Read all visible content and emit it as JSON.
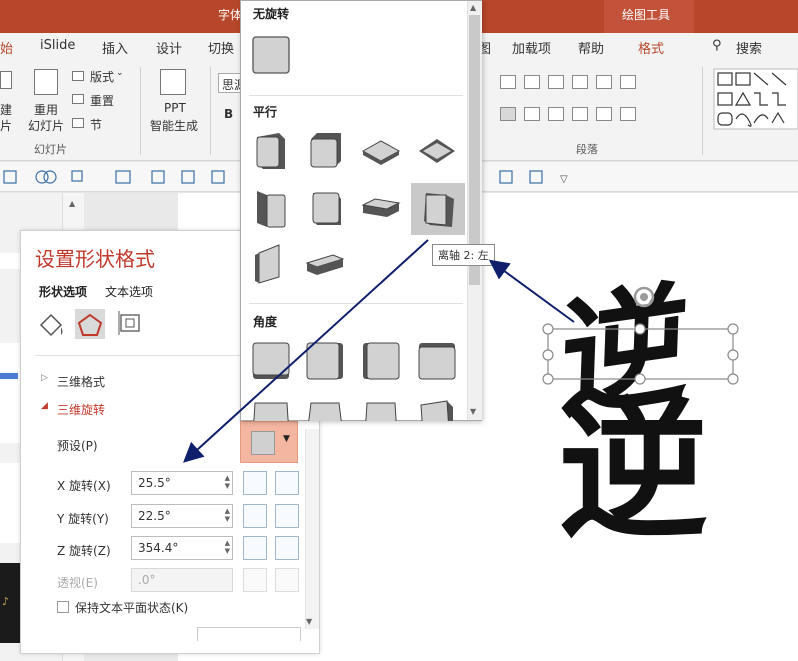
{
  "window": {
    "title": "字体",
    "context_tab": "绘图工具"
  },
  "ribbon_tabs": [
    {
      "label": "始",
      "active": true
    },
    {
      "label": "iSlide"
    },
    {
      "label": "插入"
    },
    {
      "label": "设计"
    },
    {
      "label": "切换"
    },
    {
      "label": "图"
    },
    {
      "label": "加载项"
    },
    {
      "label": "帮助"
    },
    {
      "label": "格式",
      "active": true
    },
    {
      "label": "搜索"
    }
  ],
  "ribbon": {
    "new_slide_label": "建",
    "new_slide_sub": "片",
    "reuse_label": "重用",
    "reuse_sub": "幻灯片",
    "layout_label": "版式",
    "reset_label": "重置",
    "section_label": "节",
    "group_slides": "幻灯片",
    "ppt_label": "PPT",
    "ppt_sub": "智能生成",
    "font_name": "思源",
    "bold": "B",
    "group_paragraph": "段落"
  },
  "pane": {
    "title": "设置形状格式",
    "tab_shape": "形状选项",
    "tab_text": "文本选项",
    "section_3d_format": "三维格式",
    "section_3d_rotation": "三维旋转",
    "preset_label": "预设(P)",
    "x_label": "X 旋转(X)",
    "x_value": "25.5°",
    "y_label": "Y 旋转(Y)",
    "y_value": "22.5°",
    "z_label": "Z 旋转(Z)",
    "z_value": "354.4°",
    "persp_label": "透视(E)",
    "persp_value": ".0°",
    "keep_text_flat": "保持文本平面状态(K)"
  },
  "gallery": {
    "no_rotation": "无旋转",
    "parallel": "平行",
    "angle": "角度",
    "tooltip": "离轴 2: 左"
  },
  "slide": {
    "char_top": "逆",
    "char_bottom": "逆"
  },
  "colors": {
    "accent": "#b7472a",
    "pane_title": "#c0392b",
    "arrow": "#0f1f6b",
    "preset_selected": "#f4b6a0"
  }
}
